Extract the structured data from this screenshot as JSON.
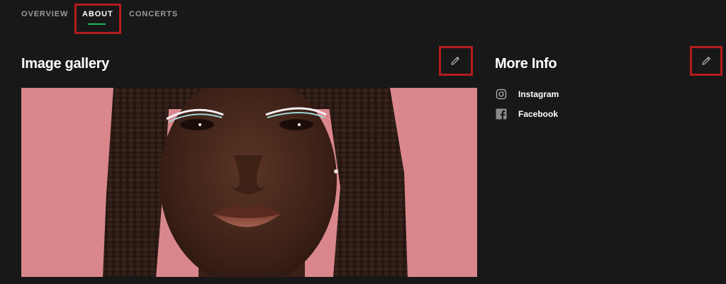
{
  "tabs": [
    {
      "label": "OVERVIEW",
      "active": false
    },
    {
      "label": "ABOUT",
      "active": true
    },
    {
      "label": "CONCERTS",
      "active": false
    }
  ],
  "gallery": {
    "title": "Image gallery",
    "edit_icon": "pencil-icon"
  },
  "more_info": {
    "title": "More Info",
    "edit_icon": "pencil-icon",
    "links": [
      {
        "label": "Instagram",
        "icon": "instagram-icon"
      },
      {
        "label": "Facebook",
        "icon": "facebook-icon"
      }
    ]
  },
  "colors": {
    "background": "#181818",
    "accent": "#1db954",
    "highlight": "#b31d1d",
    "gallery_bg": "#d9878c"
  }
}
